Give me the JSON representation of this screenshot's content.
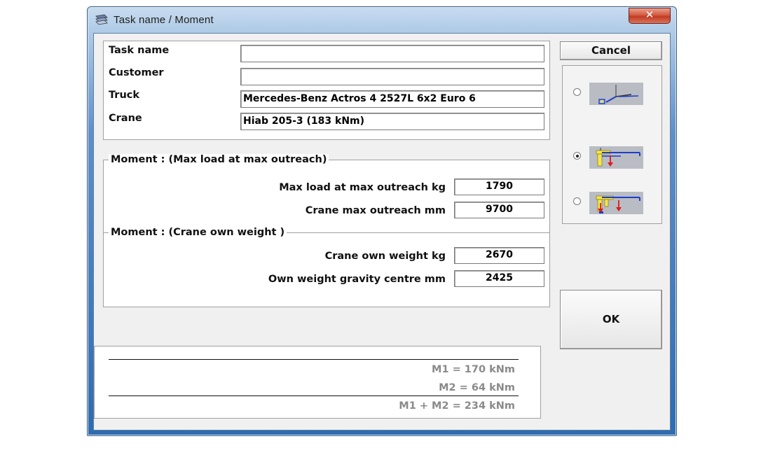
{
  "window": {
    "title": "Task name   /   Moment",
    "close_label": "✕"
  },
  "task": {
    "fields": [
      {
        "label": "Task name",
        "value": ""
      },
      {
        "label": "Customer",
        "value": ""
      },
      {
        "label": "Truck",
        "value": "Mercedes-Benz Actros 4 2527L 6x2 Euro 6"
      },
      {
        "label": "Crane",
        "value": "Hiab  205-3 (183 kNm)"
      }
    ]
  },
  "moment_max_load": {
    "title": "Moment : (Max load at max outreach)",
    "rows": [
      {
        "label": "Max load at max outreach kg",
        "value": "1790"
      },
      {
        "label": "Crane max outreach   mm",
        "value": "9700"
      }
    ]
  },
  "moment_own_weight": {
    "title": "Moment : (Crane own weight )",
    "rows": [
      {
        "label": "Crane own weight  kg",
        "value": "2670"
      },
      {
        "label": "Own weight gravity centre  mm",
        "value": "2425"
      }
    ]
  },
  "buttons": {
    "cancel": "Cancel",
    "ok": "OK"
  },
  "modes": {
    "selected": 1,
    "options": [
      "crane-folded-icon",
      "crane-max-load-icon",
      "crane-load-and-weight-icon"
    ]
  },
  "results": {
    "m1": "M1 = 170 kNm",
    "m2": "M2 = 64 kNm",
    "total": "M1 + M2 = 234 kNm"
  },
  "colors": {
    "title_bar": "#b2cde8",
    "client_bg": "#f0f0f0",
    "close_red": "#c23b22",
    "crane_yellow": "#f5e64a",
    "crane_blue": "#1e3ec8",
    "load_red": "#e01a1a"
  }
}
